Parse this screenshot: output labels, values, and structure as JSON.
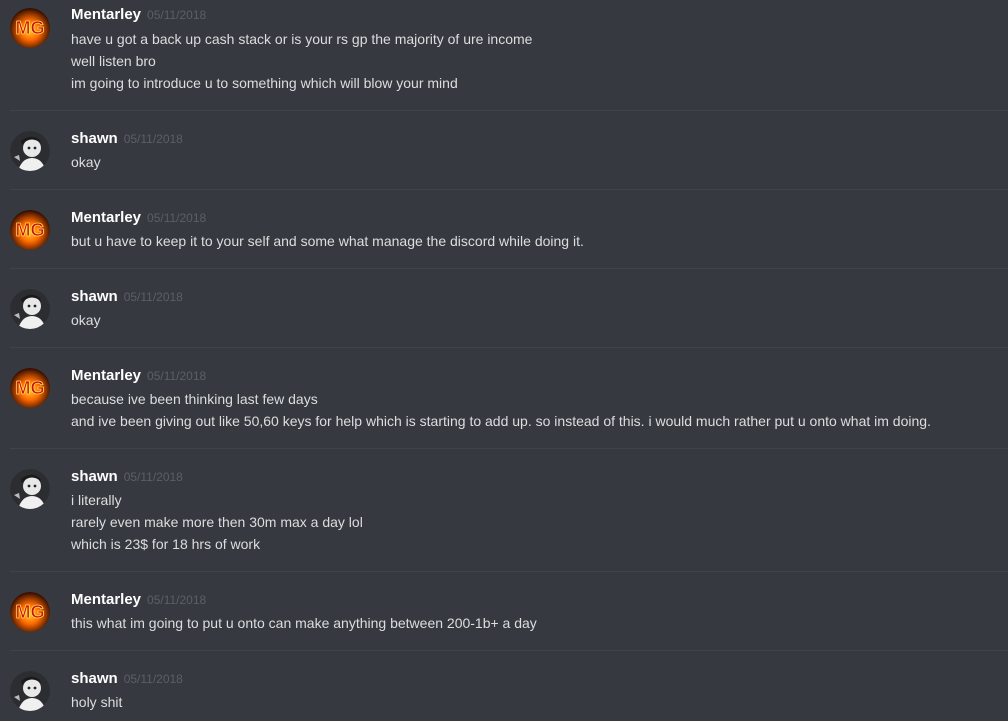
{
  "colors": {
    "background": "#36393f",
    "divider": "#40434a",
    "username": "#ffffff",
    "timestamp": "#5c5f66",
    "message_text": "#dcddde"
  },
  "avatars": {
    "mentarley": {
      "icon": "mg-fire-logo-avatar",
      "text": "MG"
    },
    "shawn": {
      "icon": "person-photo-avatar"
    }
  },
  "messages": [
    {
      "username": "Mentarley",
      "timestamp": "05/11/2018",
      "avatar": "mentarley",
      "lines": [
        "have u got a back up cash stack or is your rs gp the majority of ure income",
        "well listen bro",
        "im going to introduce u to something which will blow your mind"
      ]
    },
    {
      "username": "shawn",
      "timestamp": "05/11/2018",
      "avatar": "shawn",
      "lines": [
        "okay"
      ]
    },
    {
      "username": "Mentarley",
      "timestamp": "05/11/2018",
      "avatar": "mentarley",
      "lines": [
        "but u have to keep it to your self and some what manage the discord while doing it."
      ]
    },
    {
      "username": "shawn",
      "timestamp": "05/11/2018",
      "avatar": "shawn",
      "lines": [
        "okay"
      ]
    },
    {
      "username": "Mentarley",
      "timestamp": "05/11/2018",
      "avatar": "mentarley",
      "lines": [
        "because ive been thinking last few days",
        "and ive been giving out like 50,60 keys for help which is starting to add up. so instead of this. i would much rather put u onto what im doing."
      ]
    },
    {
      "username": "shawn",
      "timestamp": "05/11/2018",
      "avatar": "shawn",
      "lines": [
        "i literally",
        "rarely even make more then 30m max a day lol",
        "which is 23$ for 18 hrs of work"
      ]
    },
    {
      "username": "Mentarley",
      "timestamp": "05/11/2018",
      "avatar": "mentarley",
      "lines": [
        "this what im going to put u onto can make anything between 200-1b+ a day"
      ]
    },
    {
      "username": "shawn",
      "timestamp": "05/11/2018",
      "avatar": "shawn",
      "lines": [
        "holy shit"
      ]
    }
  ]
}
